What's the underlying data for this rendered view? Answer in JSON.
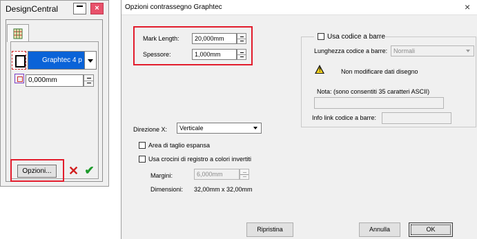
{
  "design_central": {
    "title": "DesignCentral",
    "close_glyph": "×",
    "plotter_name": "Graphtec 4 p",
    "offset_value": "0,000mm",
    "options_button": "Opzioni...",
    "cancel_glyph": "✕",
    "confirm_glyph": "✔",
    "icons": [
      "minimize-icon",
      "close-icon",
      "tab-palette-icon",
      "registration-mark-icon",
      "chevron-down-icon",
      "offset-icon",
      "cancel-x-icon",
      "check-icon"
    ]
  },
  "dialog": {
    "title": "Opzioni contrassegno Graphtec",
    "close_glyph": "×",
    "mark_length": {
      "label": "Mark Length:",
      "value": "20,000mm"
    },
    "thickness": {
      "label": "Spessore:",
      "value": "1,000mm"
    },
    "barcode": {
      "use_label": "Usa codice a barre",
      "length_label": "Lunghezza codice a barre:",
      "length_value": "Normali",
      "warning_text": "Non modificare dati disegno",
      "note_label": "Nota: (sono consentiti 35 caratteri ASCII)",
      "note_value": "",
      "link_label": "Info link codice a barre:",
      "link_value": ""
    },
    "direction": {
      "label": "Direzione X:",
      "value": "Verticale"
    },
    "expanded_cut": "Area di taglio espansa",
    "inverted_marks": "Usa crocini di registro a colori invertiti",
    "margins": {
      "label": "Margini:",
      "value": "6,000mm"
    },
    "dimensions": {
      "label": "Dimensioni:",
      "value": "32,00mm x 32,00mm"
    },
    "buttons": {
      "reset": "Ripristina",
      "cancel": "Annulla",
      "ok": "OK"
    }
  },
  "colors": {
    "highlight_red": "#e21c2c",
    "selection_blue": "#0a63d8",
    "confirm_green": "#1d9a2b"
  }
}
